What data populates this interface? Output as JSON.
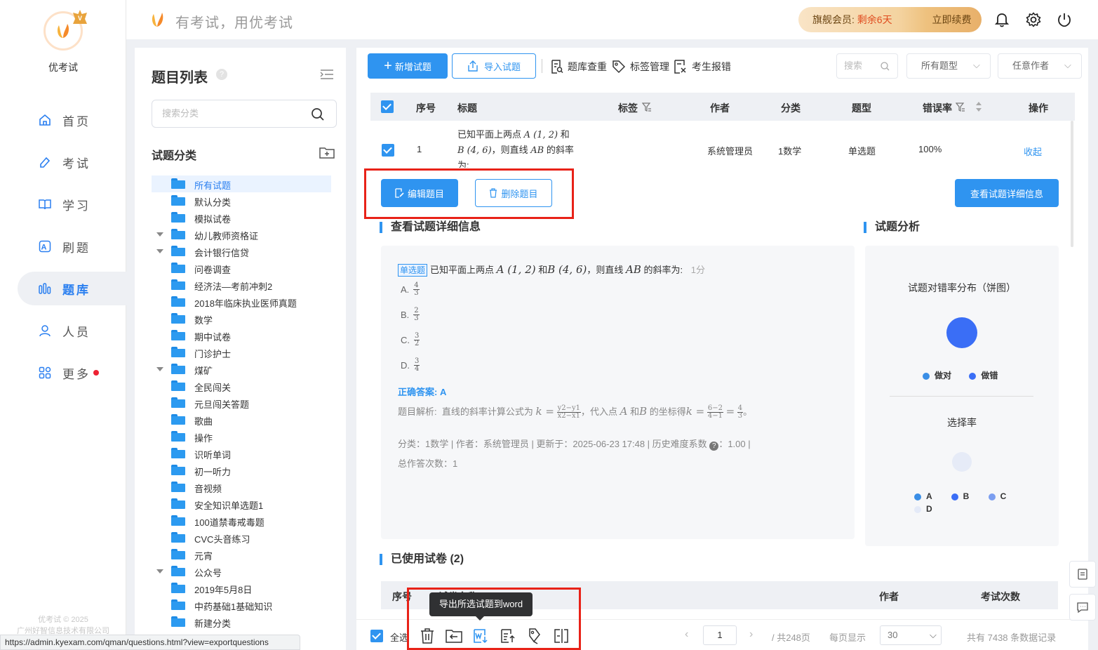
{
  "app": {
    "name": "优考试",
    "logo_badge": "V",
    "slogan": "有考试，用优考试"
  },
  "vip": {
    "label": "旗舰会员:",
    "remaining": "剩余6天",
    "renew": "立即续费"
  },
  "nav": [
    {
      "label": "首页",
      "icon": "home-icon"
    },
    {
      "label": "考试",
      "icon": "exam-icon"
    },
    {
      "label": "学习",
      "icon": "book-icon"
    },
    {
      "label": "刷题",
      "icon": "practice-icon"
    },
    {
      "label": "题库",
      "icon": "bank-icon",
      "active": true
    },
    {
      "label": "人员",
      "icon": "user-icon"
    },
    {
      "label": "更多",
      "icon": "more-icon"
    }
  ],
  "footer": {
    "line1": "优考试 © 2025",
    "line2": "广州好智信息技术有限公司"
  },
  "category_panel": {
    "title": "题目列表",
    "search_placeholder": "搜索分类",
    "section_title": "试题分类",
    "items": [
      {
        "label": "所有试题",
        "selected": true
      },
      {
        "label": "默认分类"
      },
      {
        "label": "模拟试卷"
      },
      {
        "label": "幼儿教师资格证",
        "expandable": true
      },
      {
        "label": "会计银行信贷",
        "expandable": true
      },
      {
        "label": "问卷调查"
      },
      {
        "label": "经济法—考前冲刺2"
      },
      {
        "label": "2018年临床执业医师真题"
      },
      {
        "label": "数学"
      },
      {
        "label": "期中试卷"
      },
      {
        "label": "门诊护士"
      },
      {
        "label": "煤矿",
        "expandable": true
      },
      {
        "label": "全民闯关"
      },
      {
        "label": "元旦闯关答题"
      },
      {
        "label": "歌曲"
      },
      {
        "label": "操作"
      },
      {
        "label": "识听单词"
      },
      {
        "label": "初一听力"
      },
      {
        "label": "音视频"
      },
      {
        "label": "安全知识单选题1"
      },
      {
        "label": "100道禁毒戒毒题"
      },
      {
        "label": "CVC头音练习"
      },
      {
        "label": "元宵"
      },
      {
        "label": "公众号",
        "expandable": true
      },
      {
        "label": "2019年5月8日"
      },
      {
        "label": "中药基础1基础知识"
      },
      {
        "label": "新建分类"
      }
    ]
  },
  "toolbar": {
    "add": "新增试题",
    "import": "导入试题",
    "dedupe": "题库查重",
    "tags": "标签管理",
    "report": "考生报错",
    "search_placeholder": "搜索",
    "type_filter": "所有题型",
    "author_filter": "任意作者"
  },
  "table": {
    "headers": {
      "seq": "序号",
      "title": "标题",
      "tag": "标签",
      "author": "作者",
      "category": "分类",
      "type": "题型",
      "error_rate": "错误率",
      "action": "操作"
    },
    "row": {
      "seq": "1",
      "title_prefix": "已知平面上两点",
      "title_and": "和",
      "title_line2": "，则直线",
      "title_slope": "的斜率",
      "title_line3": "为:",
      "author": "系统管理员",
      "category": "1数学",
      "type": "单选题",
      "error_rate": "100%",
      "action": "收起"
    },
    "edit_button": "编辑题目",
    "delete_button": "删除题目",
    "detail_button": "查看试题详细信息"
  },
  "detail": {
    "section_title": "查看试题详细信息",
    "type_tag": "单选题",
    "question_prefix": "已知平面上两点",
    "question_and": "和",
    "question_suffix": "，则直线",
    "question_slope": "的斜率为:",
    "score": "1分",
    "options": [
      {
        "letter": "A.",
        "num": "4",
        "den": "3"
      },
      {
        "letter": "B.",
        "num": "2",
        "den": "3"
      },
      {
        "letter": "C.",
        "num": "3",
        "den": "2"
      },
      {
        "letter": "D.",
        "num": "3",
        "den": "4"
      }
    ],
    "answer_label": "正确答案:",
    "answer_value": "A",
    "analysis_label": "题目解析:",
    "analysis_text1": "直线的斜率计算公式为",
    "analysis_text2": "，代入点",
    "analysis_text3": "和",
    "analysis_text4": "的坐标得",
    "meta_line": "分类：1数学 | 作者：系统管理员 | 更新于：2025-06-23 17:48 | 历史难度系数",
    "meta_value": "：1.00 |",
    "attempts": "总作答次数：1"
  },
  "analysis": {
    "section_title": "试题分析",
    "pie_title": "试题对错率分布（饼图）",
    "legend": [
      {
        "label": "做对",
        "color": "#3a8ee6"
      },
      {
        "label": "做错",
        "color": "#3a6ef6"
      }
    ],
    "choice_title": "选择率",
    "choice_legend": [
      {
        "label": "A",
        "color": "#3a8ee6"
      },
      {
        "label": "B",
        "color": "#3a6ef6"
      },
      {
        "label": "C",
        "color": "#7b9ef0"
      },
      {
        "label": "D",
        "color": "#e4eaf8"
      }
    ]
  },
  "used_papers": {
    "title": "已使用试卷",
    "count": "(2)",
    "headers": {
      "seq": "序号",
      "name": "试卷名称",
      "author": "作者",
      "exam_count": "考试次数"
    }
  },
  "bottom": {
    "select_all": "全选",
    "tooltip": "导出所选试题到word",
    "page": "1",
    "total_pages": "/ 共248页",
    "per_page_label": "每页显示",
    "per_page": "30",
    "total_records": "共有 7438 条数据记录"
  },
  "status_url": "https://admin.kyexam.com/qman/questions.html?view=exportquestions"
}
